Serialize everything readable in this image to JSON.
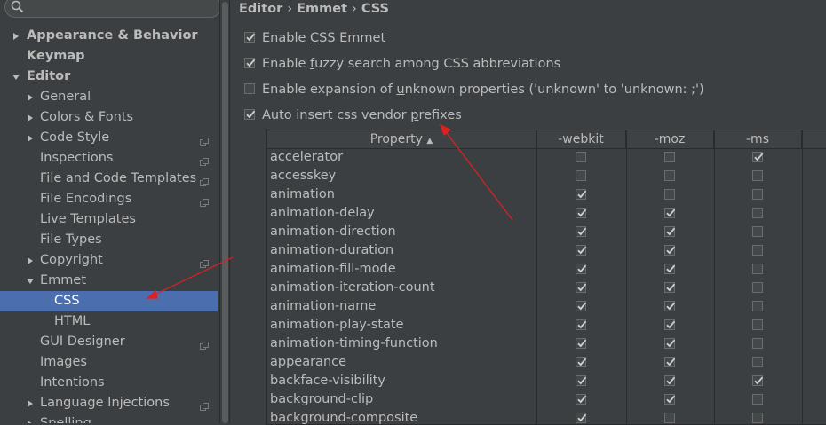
{
  "search": {
    "placeholder": ""
  },
  "sidebar": {
    "items": [
      {
        "label": "Appearance & Behavior",
        "level": 0,
        "bold": true,
        "arrow": "right",
        "cfg": false,
        "selected": false
      },
      {
        "label": "Keymap",
        "level": 0,
        "bold": true,
        "arrow": "",
        "cfg": false,
        "selected": false
      },
      {
        "label": "Editor",
        "level": 0,
        "bold": true,
        "arrow": "down",
        "cfg": false,
        "selected": false
      },
      {
        "label": "General",
        "level": 1,
        "bold": false,
        "arrow": "right",
        "cfg": false,
        "selected": false
      },
      {
        "label": "Colors & Fonts",
        "level": 1,
        "bold": false,
        "arrow": "right",
        "cfg": false,
        "selected": false
      },
      {
        "label": "Code Style",
        "level": 1,
        "bold": false,
        "arrow": "right",
        "cfg": true,
        "selected": false
      },
      {
        "label": "Inspections",
        "level": 1,
        "bold": false,
        "arrow": "",
        "cfg": true,
        "selected": false
      },
      {
        "label": "File and Code Templates",
        "level": 1,
        "bold": false,
        "arrow": "",
        "cfg": true,
        "selected": false
      },
      {
        "label": "File Encodings",
        "level": 1,
        "bold": false,
        "arrow": "",
        "cfg": true,
        "selected": false
      },
      {
        "label": "Live Templates",
        "level": 1,
        "bold": false,
        "arrow": "",
        "cfg": false,
        "selected": false
      },
      {
        "label": "File Types",
        "level": 1,
        "bold": false,
        "arrow": "",
        "cfg": false,
        "selected": false
      },
      {
        "label": "Copyright",
        "level": 1,
        "bold": false,
        "arrow": "right",
        "cfg": true,
        "selected": false
      },
      {
        "label": "Emmet",
        "level": 1,
        "bold": false,
        "arrow": "down",
        "cfg": false,
        "selected": false
      },
      {
        "label": "CSS",
        "level": 2,
        "bold": false,
        "arrow": "",
        "cfg": false,
        "selected": true
      },
      {
        "label": "HTML",
        "level": 2,
        "bold": false,
        "arrow": "",
        "cfg": false,
        "selected": false
      },
      {
        "label": "GUI Designer",
        "level": 1,
        "bold": false,
        "arrow": "",
        "cfg": true,
        "selected": false
      },
      {
        "label": "Images",
        "level": 1,
        "bold": false,
        "arrow": "",
        "cfg": false,
        "selected": false
      },
      {
        "label": "Intentions",
        "level": 1,
        "bold": false,
        "arrow": "",
        "cfg": false,
        "selected": false
      },
      {
        "label": "Language Injections",
        "level": 1,
        "bold": false,
        "arrow": "right",
        "cfg": true,
        "selected": false
      },
      {
        "label": "Spelling",
        "level": 1,
        "bold": false,
        "arrow": "right",
        "cfg": true,
        "selected": false
      }
    ]
  },
  "breadcrumb": {
    "parts": [
      "Editor",
      "Emmet",
      "CSS"
    ],
    "separator": "›"
  },
  "options": [
    {
      "pre": "Enable ",
      "mnemonic": "C",
      "post": "SS Emmet",
      "checked": true
    },
    {
      "pre": "Enable ",
      "mnemonic": "f",
      "post": "uzzy search among CSS abbreviations",
      "checked": true
    },
    {
      "pre": "Enable expansion of ",
      "mnemonic": "u",
      "post": "nknown properties ('unknown' to 'unknown: ;')",
      "checked": false
    },
    {
      "pre": "Auto insert css vendor ",
      "mnemonic": "p",
      "post": "refixes",
      "checked": true
    }
  ],
  "table": {
    "columns": [
      "Property",
      "-webkit",
      "-moz",
      "-ms"
    ],
    "sort_indicator": "▲",
    "rows": [
      {
        "name": "accelerator",
        "webkit": false,
        "moz": false,
        "ms": true
      },
      {
        "name": "accesskey",
        "webkit": false,
        "moz": false,
        "ms": false
      },
      {
        "name": "animation",
        "webkit": true,
        "moz": false,
        "ms": false
      },
      {
        "name": "animation-delay",
        "webkit": true,
        "moz": true,
        "ms": false
      },
      {
        "name": "animation-direction",
        "webkit": true,
        "moz": true,
        "ms": false
      },
      {
        "name": "animation-duration",
        "webkit": true,
        "moz": true,
        "ms": false
      },
      {
        "name": "animation-fill-mode",
        "webkit": true,
        "moz": true,
        "ms": false
      },
      {
        "name": "animation-iteration-count",
        "webkit": true,
        "moz": true,
        "ms": false
      },
      {
        "name": "animation-name",
        "webkit": true,
        "moz": true,
        "ms": false
      },
      {
        "name": "animation-play-state",
        "webkit": true,
        "moz": true,
        "ms": false
      },
      {
        "name": "animation-timing-function",
        "webkit": true,
        "moz": true,
        "ms": false
      },
      {
        "name": "appearance",
        "webkit": true,
        "moz": true,
        "ms": false
      },
      {
        "name": "backface-visibility",
        "webkit": true,
        "moz": true,
        "ms": true
      },
      {
        "name": "background-clip",
        "webkit": true,
        "moz": true,
        "ms": false
      },
      {
        "name": "background-composite",
        "webkit": true,
        "moz": false,
        "ms": false
      }
    ]
  },
  "colors": {
    "background": "#3c3f41",
    "selection": "#4b6eaf",
    "text": "#bbbbbb",
    "annotation_arrow": "#e02020"
  }
}
